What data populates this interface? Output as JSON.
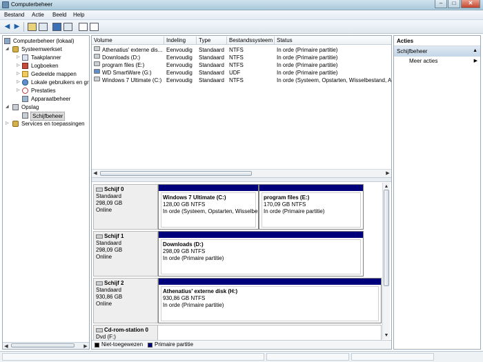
{
  "window": {
    "title": "Computerbeheer"
  },
  "menu": {
    "items": [
      "Bestand",
      "Actie",
      "Beeld",
      "Help"
    ]
  },
  "tree": {
    "items": [
      {
        "label": "Computerbeheer (lokaal)",
        "icon": "computer-icon"
      },
      {
        "label": "Systeemwerkset",
        "icon": "tools-icon"
      },
      {
        "label": "Taakplanner",
        "icon": "clock-icon"
      },
      {
        "label": "Logboeken",
        "icon": "log-icon"
      },
      {
        "label": "Gedeelde mappen",
        "icon": "folder-icon"
      },
      {
        "label": "Lokale gebruikers en groepen",
        "icon": "users-icon"
      },
      {
        "label": "Prestaties",
        "icon": "performance-icon"
      },
      {
        "label": "Apparaatbeheer",
        "icon": "device-icon"
      },
      {
        "label": "Opslag",
        "icon": "storage-icon"
      },
      {
        "label": "Schijfbeheer",
        "icon": "disk-icon"
      },
      {
        "label": "Services en toepassingen",
        "icon": "services-icon"
      }
    ]
  },
  "volumes": {
    "columns": [
      "Volume",
      "Indeling",
      "Type",
      "Bestandssysteem",
      "Status"
    ],
    "rows": [
      {
        "volume": "Athenatius' externe dis...",
        "layout": "Eenvoudig",
        "type": "Standaard",
        "fs": "NTFS",
        "status": "In orde (Primaire partitie)"
      },
      {
        "volume": "Downloads (D:)",
        "layout": "Eenvoudig",
        "type": "Standaard",
        "fs": "NTFS",
        "status": "In orde (Primaire partitie)"
      },
      {
        "volume": "program files (E:)",
        "layout": "Eenvoudig",
        "type": "Standaard",
        "fs": "NTFS",
        "status": "In orde (Primaire partitie)"
      },
      {
        "volume": "WD SmartWare (G:)",
        "layout": "Eenvoudig",
        "type": "Standaard",
        "fs": "UDF",
        "status": "In orde (Primaire partitie)"
      },
      {
        "volume": "Windows 7 Ultimate (C:)",
        "layout": "Eenvoudig",
        "type": "Standaard",
        "fs": "NTFS",
        "status": "In orde (Systeem, Opstarten, Wisselbestand, A"
      }
    ]
  },
  "disks": [
    {
      "name": "Schijf 0",
      "type": "Standaard",
      "size": "298,09 GB",
      "state": "Online",
      "partitions": [
        {
          "title": "Windows 7 Ultimate  (C:)",
          "size": "128,00 GB NTFS",
          "status": "In orde (Systeem, Opstarten, Wisselbe"
        },
        {
          "title": "program files  (E:)",
          "size": "170,09 GB NTFS",
          "status": "In orde (Primaire partitie)"
        }
      ]
    },
    {
      "name": "Schijf 1",
      "type": "Standaard",
      "size": "298,09 GB",
      "state": "Online",
      "partitions": [
        {
          "title": "Downloads  (D:)",
          "size": "298,09 GB NTFS",
          "status": "In orde (Primaire partitie)"
        }
      ]
    },
    {
      "name": "Schijf 2",
      "type": "Standaard",
      "size": "930,86 GB",
      "state": "Online",
      "partitions": [
        {
          "title": "Athenatius' externe disk  (H:)",
          "size": "930,86 GB NTFS",
          "status": "In orde (Primaire partitie)"
        }
      ]
    },
    {
      "name": "Cd-rom-station 0",
      "type": "Dvd (F:)",
      "partitions": []
    }
  ],
  "legend": [
    {
      "label": "Niet-toegewezen",
      "color": "#000000"
    },
    {
      "label": "Primaire partitie",
      "color": "#00007a"
    }
  ],
  "actions": {
    "header": "Acties",
    "group": "Schijfbeheer",
    "items": [
      "Meer acties"
    ]
  }
}
